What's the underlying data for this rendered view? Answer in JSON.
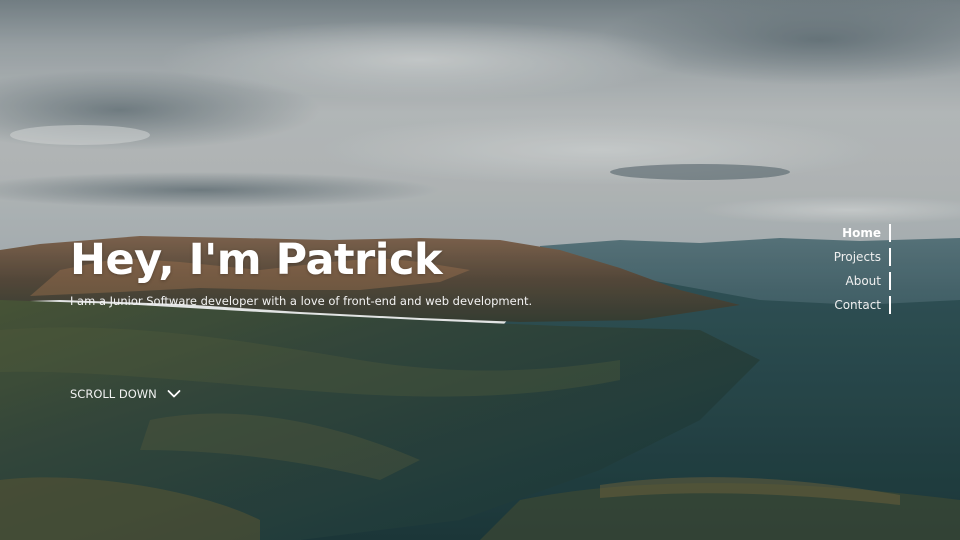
{
  "hero": {
    "title": "Hey, I'm Patrick",
    "subtitle": "I am a Junior Software developer with a love of front-end and web development.",
    "scroll_label": "SCROLL DOWN",
    "scroll_icon": "chevron-down-icon",
    "background": "mountain-valley-landscape"
  },
  "nav": {
    "items": [
      {
        "label": "Home",
        "active": true
      },
      {
        "label": "Projects",
        "active": false
      },
      {
        "label": "About",
        "active": false
      },
      {
        "label": "Contact",
        "active": false
      }
    ],
    "indicator_color": "#ffffff"
  },
  "colors": {
    "text": "#ffffff",
    "sky": "#c9ccce",
    "valley": "#2c4a4c"
  }
}
